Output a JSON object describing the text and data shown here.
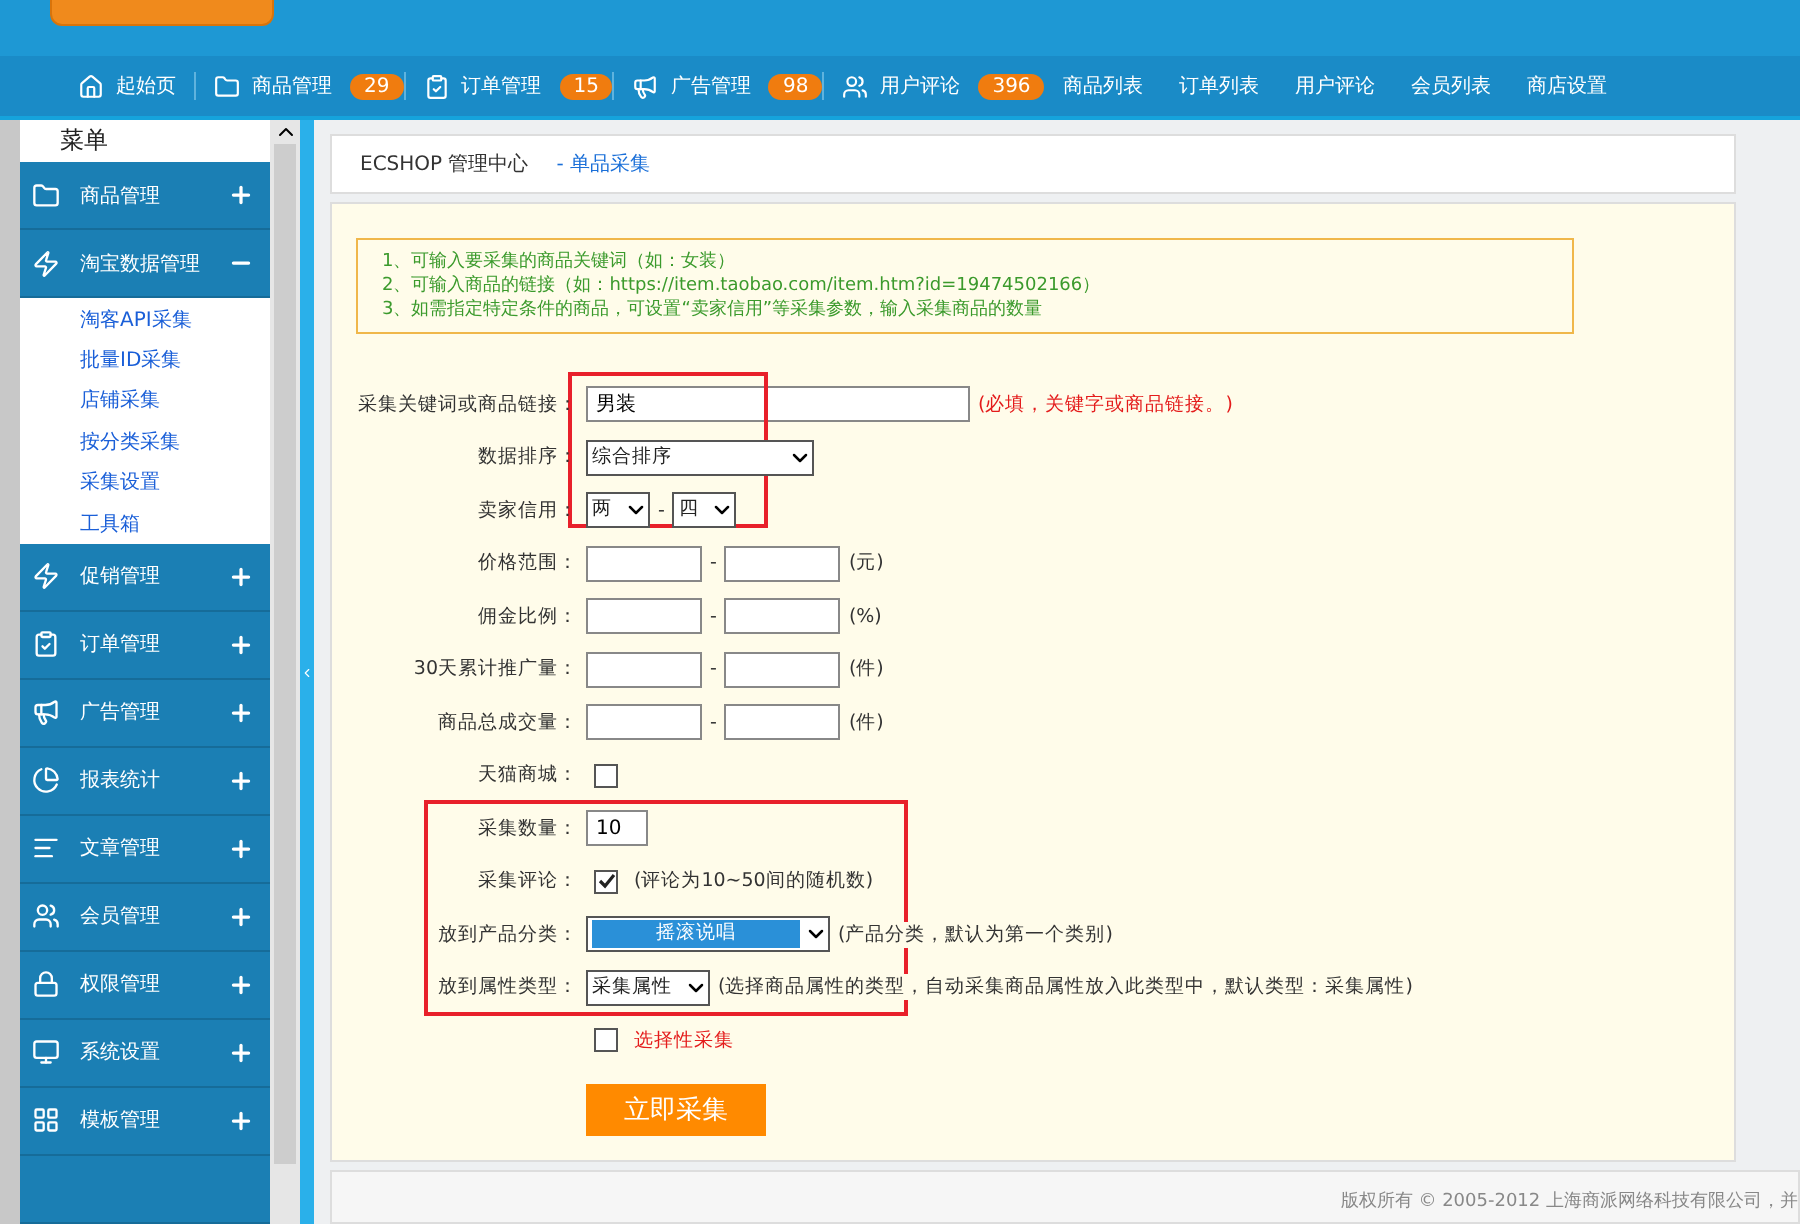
{
  "nav": [
    {
      "label": "起始页"
    },
    {
      "label": "商品管理",
      "badge": "29"
    },
    {
      "label": "订单管理",
      "badge": "15"
    },
    {
      "label": "广告管理",
      "badge": "98"
    },
    {
      "label": "用户评论",
      "badge": "396"
    },
    {
      "label": "商品列表"
    },
    {
      "label": "订单列表"
    },
    {
      "label": "用户评论"
    },
    {
      "label": "会员列表"
    },
    {
      "label": "商店设置"
    }
  ],
  "sidebar": {
    "title": "菜单",
    "items": [
      {
        "label": "商品管理",
        "expanded": false
      },
      {
        "label": "淘宝数据管理",
        "expanded": true,
        "children": [
          {
            "label": "淘客API采集"
          },
          {
            "label": "批量ID采集"
          },
          {
            "label": "店铺采集"
          },
          {
            "label": "按分类采集"
          },
          {
            "label": "采集设置"
          },
          {
            "label": "工具箱"
          }
        ]
      },
      {
        "label": "促销管理",
        "expanded": false
      },
      {
        "label": "订单管理",
        "expanded": false
      },
      {
        "label": "广告管理",
        "expanded": false
      },
      {
        "label": "报表统计",
        "expanded": false
      },
      {
        "label": "文章管理",
        "expanded": false
      },
      {
        "label": "会员管理",
        "expanded": false
      },
      {
        "label": "权限管理",
        "expanded": false
      },
      {
        "label": "系统设置",
        "expanded": false
      },
      {
        "label": "模板管理",
        "expanded": false
      }
    ]
  },
  "breadcrumb": {
    "home": "ECSHOP 管理中心",
    "current": "- 单品采集"
  },
  "tips": [
    "1、可输入要采集的商品关键词（如：女装）",
    "2、可输入商品的链接（如：https://item.taobao.com/item.htm?id=19474502166）",
    "3、如需指定特定条件的商品，可设置“卖家信用”等采集参数，输入采集商品的数量"
  ],
  "form": [
    {
      "kind": "text",
      "label": "采集关键词或商品链接：",
      "value": "男装",
      "note": "(必填，关键字或商品链接。)"
    },
    {
      "kind": "select",
      "label": "数据排序：",
      "value": "综合排序"
    },
    {
      "kind": "pair",
      "label": "卖家信用：",
      "values": [
        "两",
        "四"
      ],
      "separator": "-"
    },
    {
      "kind": "range",
      "label": "价格范围：",
      "separator": "-",
      "unit": "(元)"
    },
    {
      "kind": "range",
      "label": "佣金比例：",
      "separator": "-",
      "unit": "(%)"
    },
    {
      "kind": "range",
      "label": "30天累计推广量：",
      "separator": "-",
      "unit": "(件)"
    },
    {
      "kind": "range",
      "label": "商品总成交量：",
      "separator": "-",
      "unit": "(件)"
    },
    {
      "kind": "checkbox",
      "label": "天猫商城：",
      "checked": false
    },
    {
      "kind": "number",
      "label": "采集数量：",
      "value": "10"
    },
    {
      "kind": "checkbox",
      "label": "采集评论：",
      "checked": true,
      "note": "(评论为10~50间的随机数)"
    },
    {
      "kind": "select",
      "label": "放到产品分类：",
      "value": "摇滚说唱",
      "selected": true,
      "note": "(产品分类，默认为第一个类别)"
    },
    {
      "kind": "select",
      "label": "放到属性类型：",
      "value": "采集属性",
      "note": "(选择商品属性的类型，自动采集商品属性放入此类型中，默认类型：采集属性)"
    }
  ],
  "selective": {
    "label": "选择性采集",
    "checked": false
  },
  "submit": "立即采集",
  "footer": "版权所有 © 2005-2012 上海商派网络科技有限公司，并"
}
